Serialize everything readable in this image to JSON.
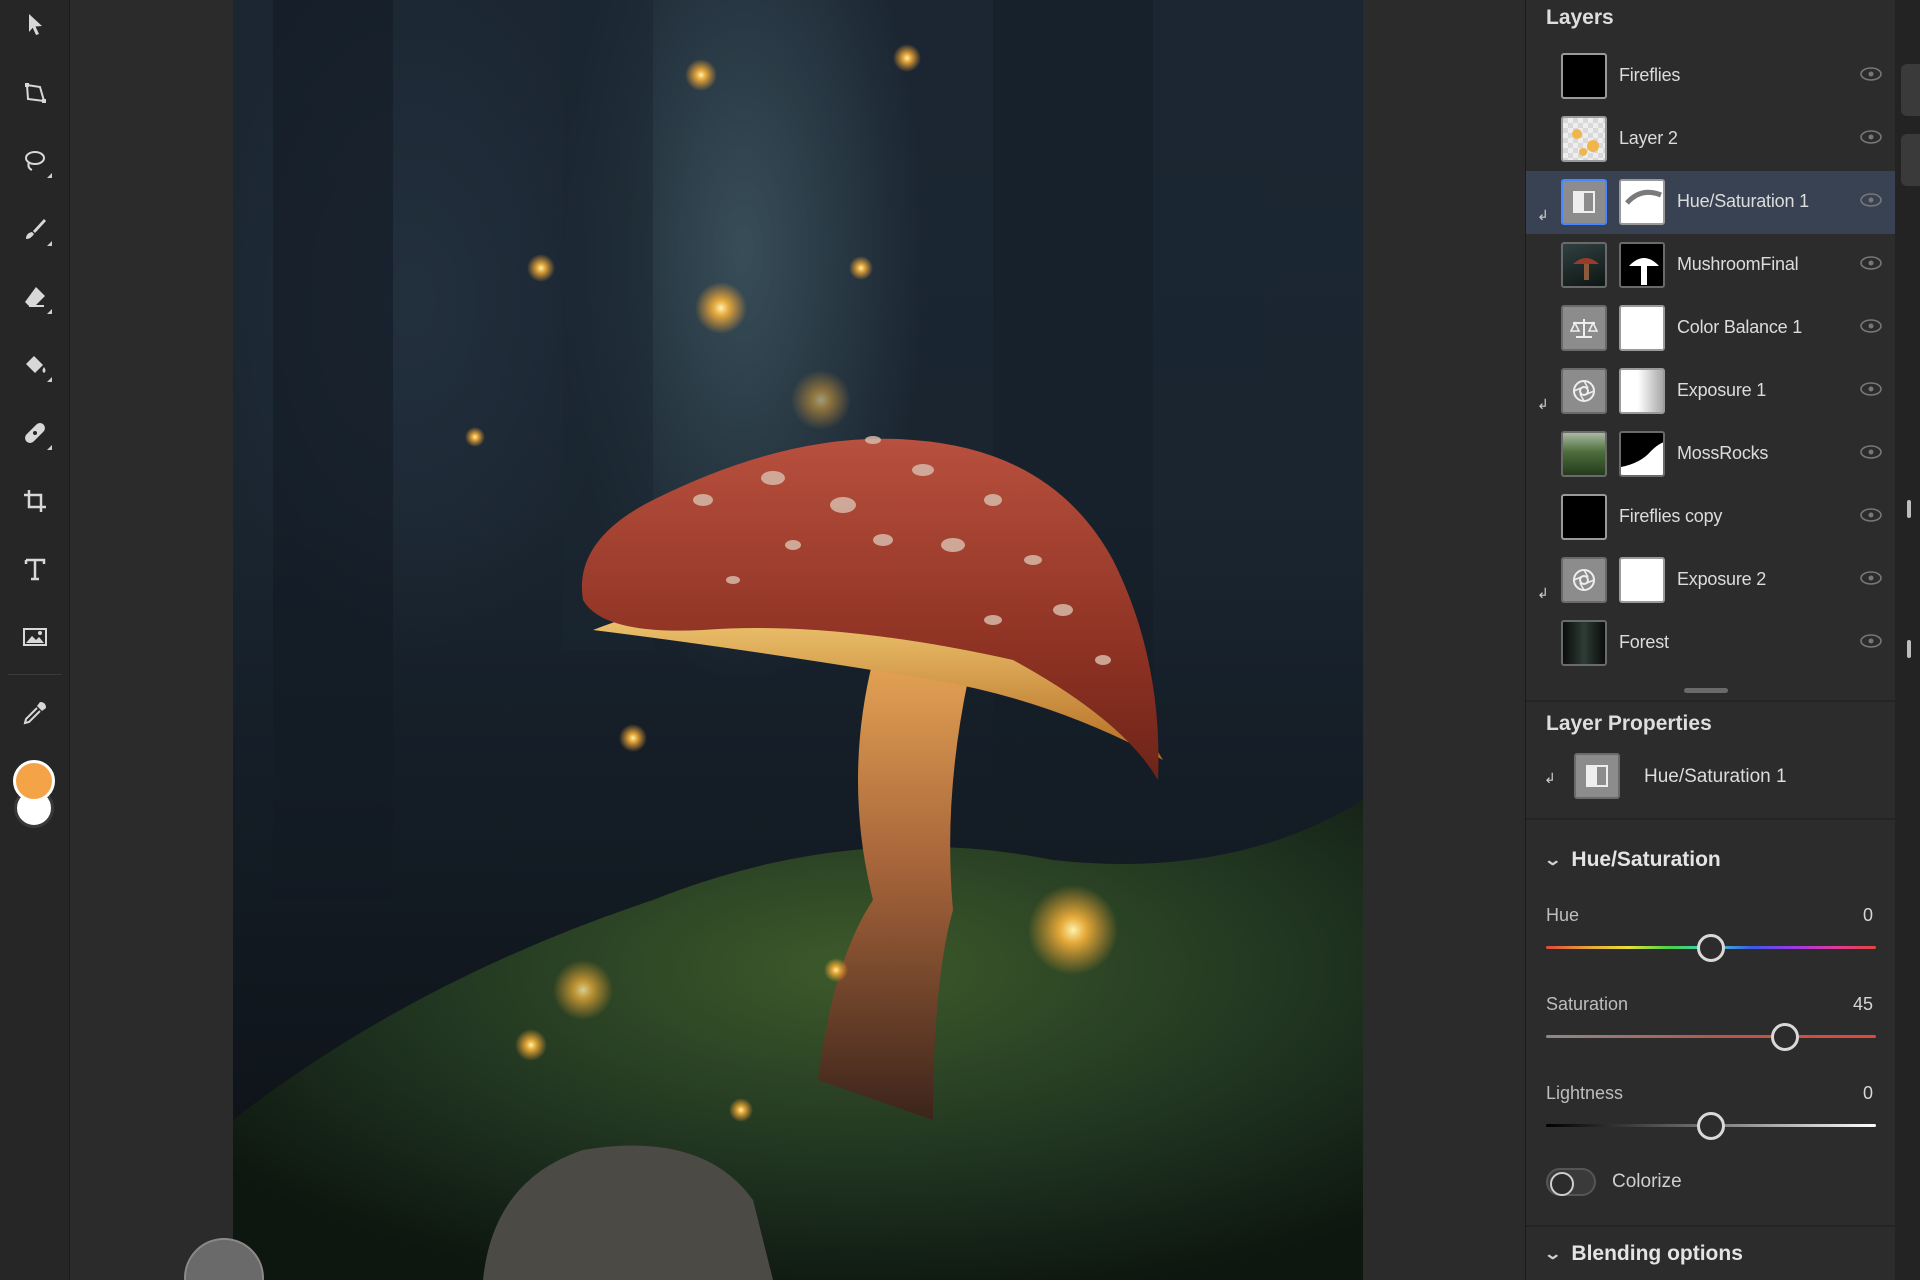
{
  "toolbar": {
    "tools": [
      {
        "name": "select-tool",
        "icon": "arrow-pointer-icon"
      },
      {
        "name": "transform-tool",
        "icon": "transform-icon"
      },
      {
        "name": "lasso-tool",
        "icon": "lasso-icon"
      },
      {
        "name": "brush-tool",
        "icon": "brush-icon"
      },
      {
        "name": "eraser-tool",
        "icon": "eraser-icon"
      },
      {
        "name": "fill-tool",
        "icon": "paint-bucket-icon"
      },
      {
        "name": "healing-tool",
        "icon": "bandage-icon"
      },
      {
        "name": "crop-tool",
        "icon": "crop-icon"
      },
      {
        "name": "type-tool",
        "icon": "type-icon"
      },
      {
        "name": "place-image-tool",
        "icon": "image-icon"
      },
      {
        "name": "eyedropper-tool",
        "icon": "eyedropper-icon"
      }
    ],
    "foreground_color": "#f5a347",
    "background_color": "#ffffff"
  },
  "layers": {
    "title": "Layers",
    "items": [
      {
        "name": "Fireflies",
        "thumb": "black",
        "mask": false,
        "clipped": false,
        "selected": false
      },
      {
        "name": "Layer 2",
        "thumb": "checker",
        "mask": false,
        "clipped": false,
        "selected": false
      },
      {
        "name": "Hue/Saturation 1",
        "thumb": "adjustment-hue",
        "mask": "white-curve",
        "clipped": true,
        "selected": true
      },
      {
        "name": "MushroomFinal",
        "thumb": "photo-mushroom",
        "mask": "black-mushroom",
        "clipped": false,
        "selected": false
      },
      {
        "name": "Color Balance 1",
        "thumb": "adjustment-balance",
        "mask": "white",
        "clipped": false,
        "selected": false
      },
      {
        "name": "Exposure 1",
        "thumb": "adjustment-exposure",
        "mask": "white-fade",
        "clipped": true,
        "selected": false
      },
      {
        "name": "MossRocks",
        "thumb": "photo-moss",
        "mask": "black-slope",
        "clipped": false,
        "selected": false
      },
      {
        "name": "Fireflies copy",
        "thumb": "black",
        "mask": false,
        "clipped": false,
        "selected": false
      },
      {
        "name": "Exposure 2",
        "thumb": "adjustment-exposure",
        "mask": "white",
        "clipped": true,
        "selected": false
      },
      {
        "name": "Forest",
        "thumb": "photo-forest",
        "mask": false,
        "clipped": false,
        "selected": false
      }
    ]
  },
  "properties": {
    "title": "Layer Properties",
    "layer_name": "Hue/Saturation 1",
    "section": "Hue/Saturation",
    "sliders": [
      {
        "label": "Hue",
        "value": "0",
        "fraction": 0.5
      },
      {
        "label": "Saturation",
        "value": "45",
        "fraction": 0.725
      },
      {
        "label": "Lightness",
        "value": "0",
        "fraction": 0.5
      }
    ],
    "colorize_label": "Colorize",
    "colorize_on": false,
    "blending_section": "Blending options"
  }
}
